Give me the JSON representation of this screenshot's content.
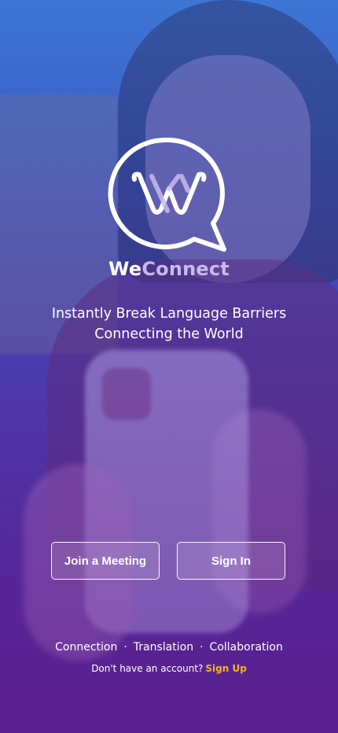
{
  "app": {
    "brand_part1": "We",
    "brand_part2": "Connect",
    "logo_icon": "speech-bubble-w-icon"
  },
  "tagline": {
    "line1": "Instantly Break Language Barriers",
    "line2": "Connecting the World"
  },
  "actions": {
    "join_label": "Join a Meeting",
    "signin_label": "Sign In"
  },
  "features": {
    "items": [
      "Connection",
      "Translation",
      "Collaboration"
    ],
    "separator": "·"
  },
  "signup": {
    "prompt": "Don't have an account?",
    "link_label": "Sign Up"
  },
  "colors": {
    "accent": "#f5b41c",
    "brand_secondary": "#c9b9ec",
    "gradient_top": "#3f79d6",
    "gradient_bottom": "#5a1f8e"
  }
}
